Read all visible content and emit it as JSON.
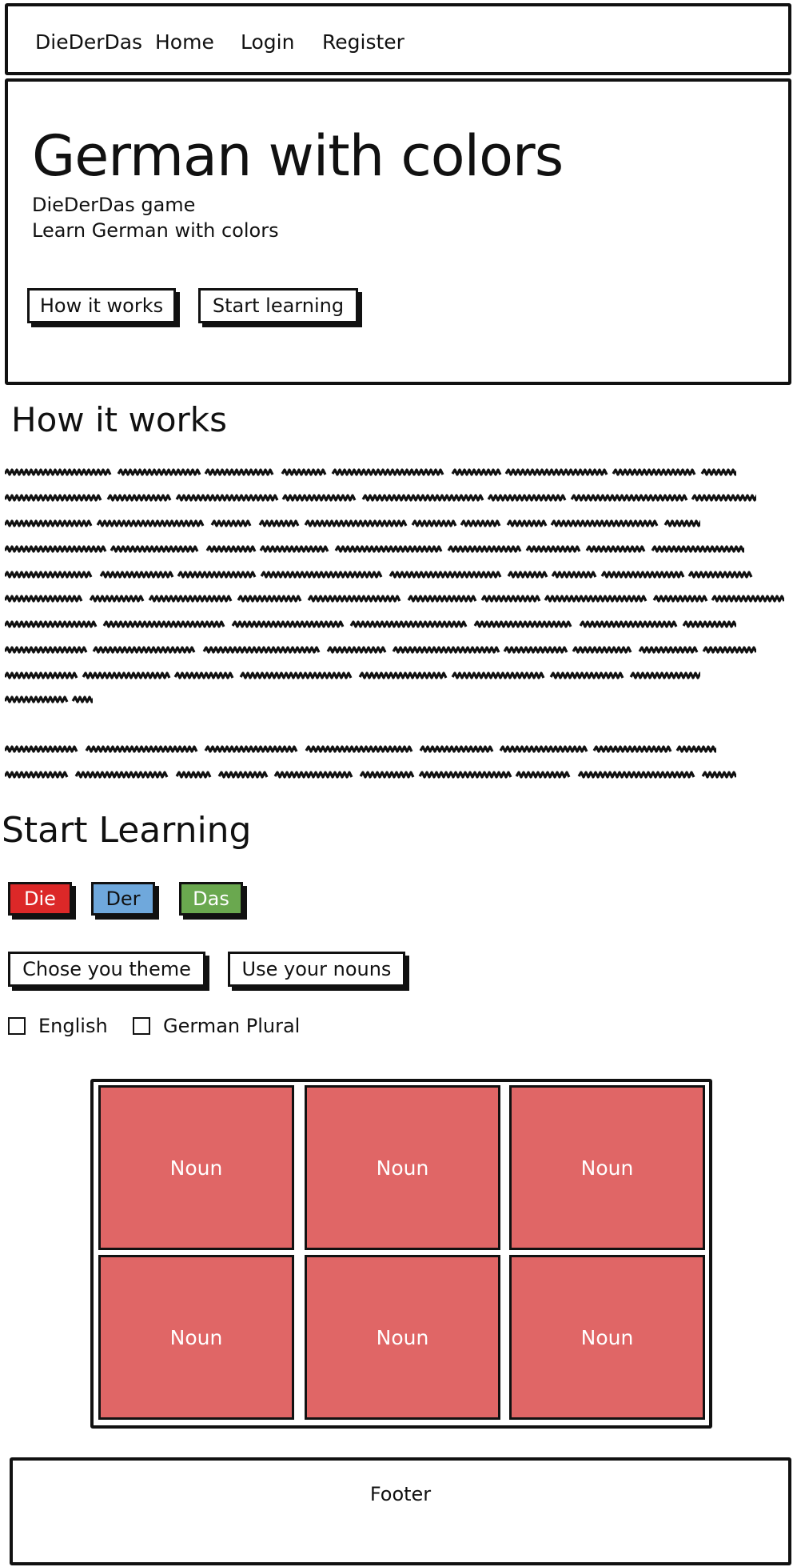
{
  "navbar": {
    "brand": "DieDerDas",
    "links": [
      "Home",
      "Login",
      "Register"
    ]
  },
  "hero": {
    "title": "German with colors",
    "subtitle_line1": "DieDerDas game",
    "subtitle_line2": "Learn German with colors",
    "buttons": [
      "How it works",
      "Start learning"
    ]
  },
  "how_it_works": {
    "heading": "How it works"
  },
  "start_learning": {
    "heading": "Start Learning",
    "genders": [
      {
        "label": "Die",
        "color": "#dc2828",
        "text_color": "#ffffff"
      },
      {
        "label": "Der",
        "color": "#6fa8dc",
        "text_color": "#111111"
      },
      {
        "label": "Das",
        "color": "#6aa84f",
        "text_color": "#ffffff"
      }
    ],
    "options": [
      "Chose you theme",
      "Use your nouns"
    ],
    "checkboxes": [
      "English",
      "German Plural"
    ]
  },
  "noun_grid": {
    "cards": [
      "Noun",
      "Noun",
      "Noun",
      "Noun",
      "Noun",
      "Noun"
    ],
    "card_color": "#e06666"
  },
  "footer": {
    "label": "Footer"
  }
}
